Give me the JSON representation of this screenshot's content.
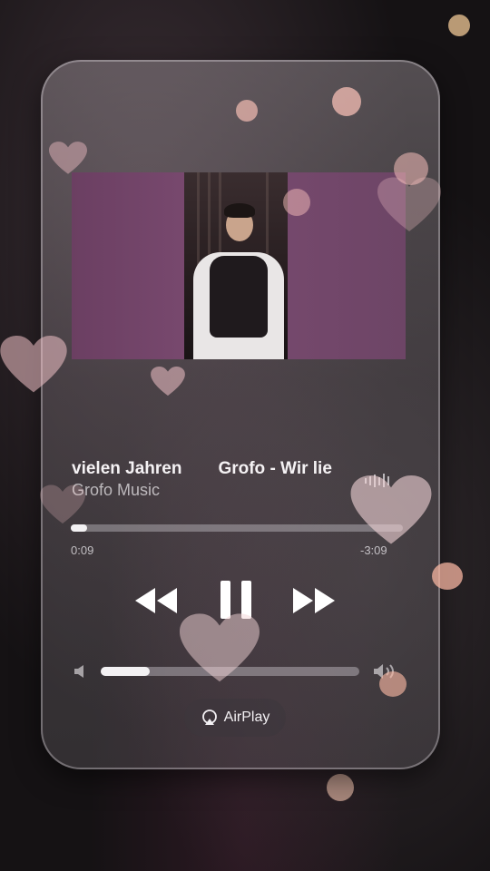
{
  "track": {
    "title_part_1": "vielen Jahren",
    "title_part_2": "Grofo - Wir lie",
    "artist": "Grofo Music"
  },
  "progress": {
    "elapsed": "0:09",
    "remaining": "-3:09",
    "fraction": 0.05
  },
  "controls": {
    "rewind_icon": "rewind-icon",
    "pause_icon": "pause-icon",
    "forward_icon": "fast-forward-icon"
  },
  "volume": {
    "low_icon": "volume-low-icon",
    "high_icon": "volume-high-icon",
    "level": 0.19
  },
  "airplay": {
    "label": "AirPlay",
    "icon": "airplay-icon"
  },
  "colors": {
    "artwork_purple": "#7a4a70",
    "text_primary": "#f5f2f4",
    "heart_pink": "#f3c2c8"
  }
}
